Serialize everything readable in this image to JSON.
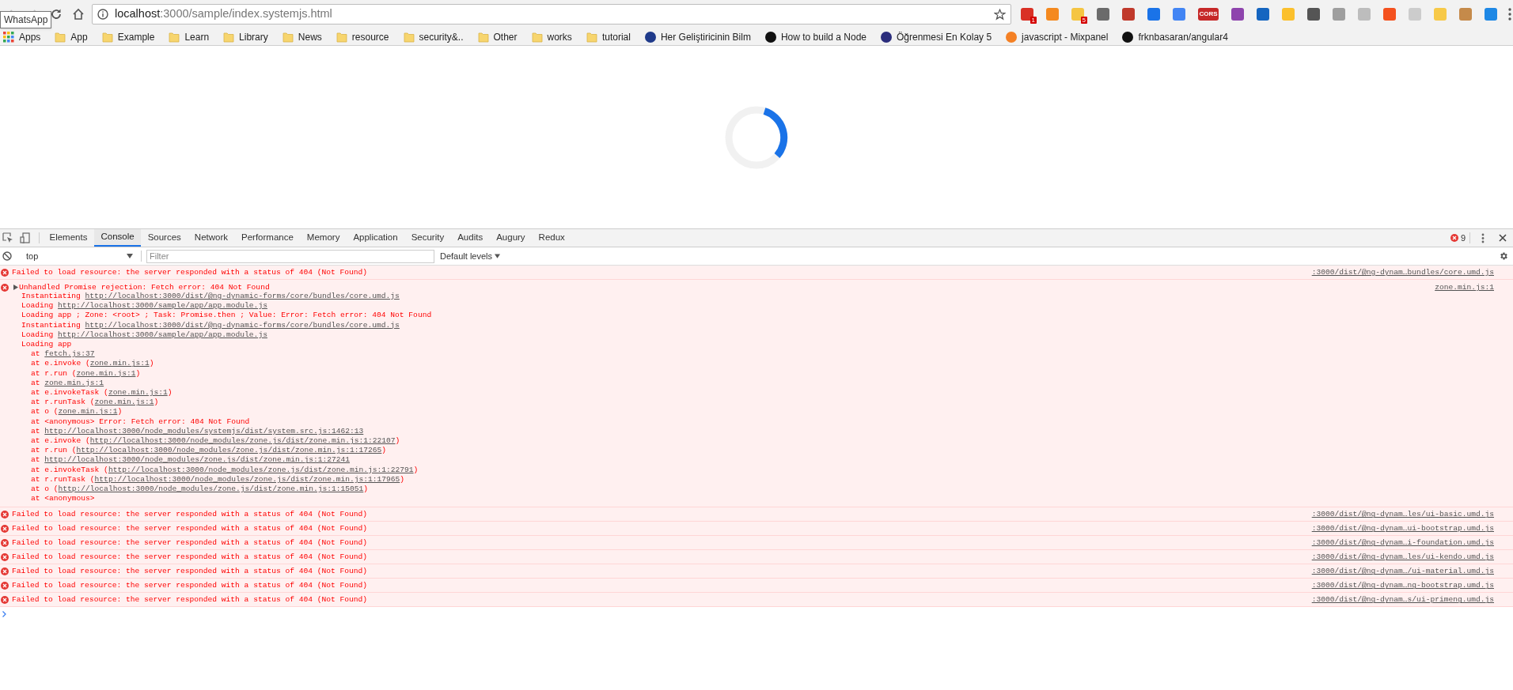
{
  "browser": {
    "nav": [
      {
        "kind": "back",
        "disabled": true
      },
      {
        "kind": "forward",
        "disabled": true
      },
      {
        "kind": "reload",
        "disabled": false
      },
      {
        "kind": "home",
        "disabled": false
      }
    ],
    "tooltip": "WhatsApp",
    "address": {
      "host": "localhost",
      "rest": ":3000/sample/index.systemjs.html"
    },
    "extensions": [
      {
        "color": "#d93025",
        "badge": "1"
      },
      {
        "color": "#f4891f"
      },
      {
        "color": "#f5c542",
        "badge": "5"
      },
      {
        "color": "#6b6b6b"
      },
      {
        "color": "#c0392b"
      },
      {
        "color": "#1a73e8"
      },
      {
        "color": "#4285f4"
      },
      {
        "color": "#c62828",
        "label": "CORS"
      },
      {
        "color": "#8e44ad"
      },
      {
        "color": "#1565c0"
      },
      {
        "color": "#fbc02d"
      },
      {
        "color": "#555555"
      },
      {
        "color": "#9e9e9e"
      },
      {
        "color": "#bdbdbd"
      },
      {
        "color": "#f4511e"
      },
      {
        "color": "#cccccc"
      },
      {
        "color": "#f7c948"
      },
      {
        "color": "#c58a4a"
      },
      {
        "color": "#1e88e5"
      }
    ],
    "bookmarks": [
      {
        "kind": "apps",
        "label": "Apps"
      },
      {
        "kind": "folder",
        "label": "App"
      },
      {
        "kind": "folder",
        "label": "Example"
      },
      {
        "kind": "folder",
        "label": "Learn"
      },
      {
        "kind": "folder",
        "label": "Library"
      },
      {
        "kind": "folder",
        "label": "News"
      },
      {
        "kind": "folder",
        "label": "resource"
      },
      {
        "kind": "folder",
        "label": "security&.."
      },
      {
        "kind": "folder",
        "label": "Other"
      },
      {
        "kind": "folder",
        "label": "works"
      },
      {
        "kind": "folder",
        "label": "tutorial"
      },
      {
        "kind": "site",
        "label": "Her Geliştiricinin Bilm",
        "color": "#1f3a8a"
      },
      {
        "kind": "site",
        "label": "How to build a Node",
        "color": "#111111"
      },
      {
        "kind": "site",
        "label": "Öğrenmesi En Kolay 5",
        "color": "#2b2d7c"
      },
      {
        "kind": "site",
        "label": "javascript - Mixpanel",
        "color": "#f48024"
      },
      {
        "kind": "site",
        "label": "frknbasaran/angular4",
        "color": "#111111"
      }
    ]
  },
  "page": {
    "loading": true
  },
  "devtools": {
    "tabs": [
      {
        "label": "Elements",
        "selected": false
      },
      {
        "label": "Console",
        "selected": true
      },
      {
        "label": "Sources",
        "selected": false
      },
      {
        "label": "Network",
        "selected": false
      },
      {
        "label": "Performance",
        "selected": false
      },
      {
        "label": "Memory",
        "selected": false
      },
      {
        "label": "Application",
        "selected": false
      },
      {
        "label": "Security",
        "selected": false
      },
      {
        "label": "Audits",
        "selected": false
      },
      {
        "label": "Augury",
        "selected": false
      },
      {
        "label": "Redux",
        "selected": false
      }
    ],
    "error_count": "9",
    "context": "top",
    "filter": {
      "placeholder": "Filter"
    },
    "levels": "Default levels",
    "messages": [
      {
        "kind": "error",
        "expandable": false,
        "text": "Failed to load resource: the server responded with a status of 404 (Not Found)",
        "source": ":3000/dist/@ng-dynam…bundles/core.umd.js"
      },
      {
        "kind": "error",
        "expandable": true,
        "text": "Unhandled Promise rejection: Fetch error: 404 Not Found",
        "source": "zone.min.js:1",
        "lines": [
          {
            "kind": "detail",
            "parts": [
              {
                "text": "Instantiating "
              },
              {
                "text": "http://localhost:3000/dist/@ng-dynamic-forms/core/bundles/core.umd.js",
                "link": true
              }
            ]
          },
          {
            "kind": "detail",
            "parts": [
              {
                "text": "Loading "
              },
              {
                "text": "http://localhost:3000/sample/app/app.module.js",
                "link": true
              }
            ]
          },
          {
            "kind": "detail",
            "parts": [
              {
                "text": "Loading app ; Zone: <root> ; Task: Promise.then ; Value: Error: Fetch error: 404 Not Found"
              }
            ]
          },
          {
            "kind": "detail",
            "parts": [
              {
                "text": "Instantiating "
              },
              {
                "text": "http://localhost:3000/dist/@ng-dynamic-forms/core/bundles/core.umd.js",
                "link": true
              }
            ]
          },
          {
            "kind": "detail",
            "parts": [
              {
                "text": "Loading "
              },
              {
                "text": "http://localhost:3000/sample/app/app.module.js",
                "link": true
              }
            ]
          },
          {
            "kind": "detail",
            "parts": [
              {
                "text": "Loading app"
              }
            ]
          },
          {
            "kind": "frame",
            "parts": [
              {
                "text": "at "
              },
              {
                "text": "fetch.js:37",
                "link": true
              }
            ]
          },
          {
            "kind": "frame",
            "parts": [
              {
                "text": "at e.invoke ("
              },
              {
                "text": "zone.min.js:1",
                "link": true
              },
              {
                "text": ")"
              }
            ]
          },
          {
            "kind": "frame",
            "parts": [
              {
                "text": "at r.run ("
              },
              {
                "text": "zone.min.js:1",
                "link": true
              },
              {
                "text": ")"
              }
            ]
          },
          {
            "kind": "frame",
            "parts": [
              {
                "text": "at "
              },
              {
                "text": "zone.min.js:1",
                "link": true
              }
            ]
          },
          {
            "kind": "frame",
            "parts": [
              {
                "text": "at e.invokeTask ("
              },
              {
                "text": "zone.min.js:1",
                "link": true
              },
              {
                "text": ")"
              }
            ]
          },
          {
            "kind": "frame",
            "parts": [
              {
                "text": "at r.runTask ("
              },
              {
                "text": "zone.min.js:1",
                "link": true
              },
              {
                "text": ")"
              }
            ]
          },
          {
            "kind": "frame",
            "parts": [
              {
                "text": "at o ("
              },
              {
                "text": "zone.min.js:1",
                "link": true
              },
              {
                "text": ")"
              }
            ]
          },
          {
            "kind": "frame",
            "parts": [
              {
                "text": "at <anonymous> Error: Fetch error: 404 Not Found"
              }
            ]
          },
          {
            "kind": "frame",
            "parts": [
              {
                "text": "at "
              },
              {
                "text": "http://localhost:3000/node_modules/systemjs/dist/system.src.js:1462:13",
                "link": true
              }
            ]
          },
          {
            "kind": "frame",
            "parts": [
              {
                "text": "at e.invoke ("
              },
              {
                "text": "http://localhost:3000/node_modules/zone.js/dist/zone.min.js:1:22107",
                "link": true
              },
              {
                "text": ")"
              }
            ]
          },
          {
            "kind": "frame",
            "parts": [
              {
                "text": "at r.run ("
              },
              {
                "text": "http://localhost:3000/node_modules/zone.js/dist/zone.min.js:1:17265",
                "link": true
              },
              {
                "text": ")"
              }
            ]
          },
          {
            "kind": "frame",
            "parts": [
              {
                "text": "at "
              },
              {
                "text": "http://localhost:3000/node_modules/zone.js/dist/zone.min.js:1:27241",
                "link": true
              }
            ]
          },
          {
            "kind": "frame",
            "parts": [
              {
                "text": "at e.invokeTask ("
              },
              {
                "text": "http://localhost:3000/node_modules/zone.js/dist/zone.min.js:1:22791",
                "link": true
              },
              {
                "text": ")"
              }
            ]
          },
          {
            "kind": "frame",
            "parts": [
              {
                "text": "at r.runTask ("
              },
              {
                "text": "http://localhost:3000/node_modules/zone.js/dist/zone.min.js:1:17965",
                "link": true
              },
              {
                "text": ")"
              }
            ]
          },
          {
            "kind": "frame",
            "parts": [
              {
                "text": "at o ("
              },
              {
                "text": "http://localhost:3000/node_modules/zone.js/dist/zone.min.js:1:15051",
                "link": true
              },
              {
                "text": ")"
              }
            ]
          },
          {
            "kind": "frame",
            "parts": [
              {
                "text": "at <anonymous>"
              }
            ]
          }
        ]
      },
      {
        "kind": "error",
        "expandable": false,
        "text": "Failed to load resource: the server responded with a status of 404 (Not Found)",
        "source": ":3000/dist/@ng-dynam…les/ui-basic.umd.js"
      },
      {
        "kind": "error",
        "expandable": false,
        "text": "Failed to load resource: the server responded with a status of 404 (Not Found)",
        "source": ":3000/dist/@ng-dynam…ui-bootstrap.umd.js"
      },
      {
        "kind": "error",
        "expandable": false,
        "text": "Failed to load resource: the server responded with a status of 404 (Not Found)",
        "source": ":3000/dist/@ng-dynam…i-foundation.umd.js"
      },
      {
        "kind": "error",
        "expandable": false,
        "text": "Failed to load resource: the server responded with a status of 404 (Not Found)",
        "source": ":3000/dist/@ng-dynam…les/ui-kendo.umd.js"
      },
      {
        "kind": "error",
        "expandable": false,
        "text": "Failed to load resource: the server responded with a status of 404 (Not Found)",
        "source": ":3000/dist/@ng-dynam…/ui-material.umd.js"
      },
      {
        "kind": "error",
        "expandable": false,
        "text": "Failed to load resource: the server responded with a status of 404 (Not Found)",
        "source": ":3000/dist/@ng-dynam…ng-bootstrap.umd.js"
      },
      {
        "kind": "error",
        "expandable": false,
        "text": "Failed to load resource: the server responded with a status of 404 (Not Found)",
        "source": ":3000/dist/@ng-dynam…s/ui-primeng.umd.js"
      }
    ]
  }
}
